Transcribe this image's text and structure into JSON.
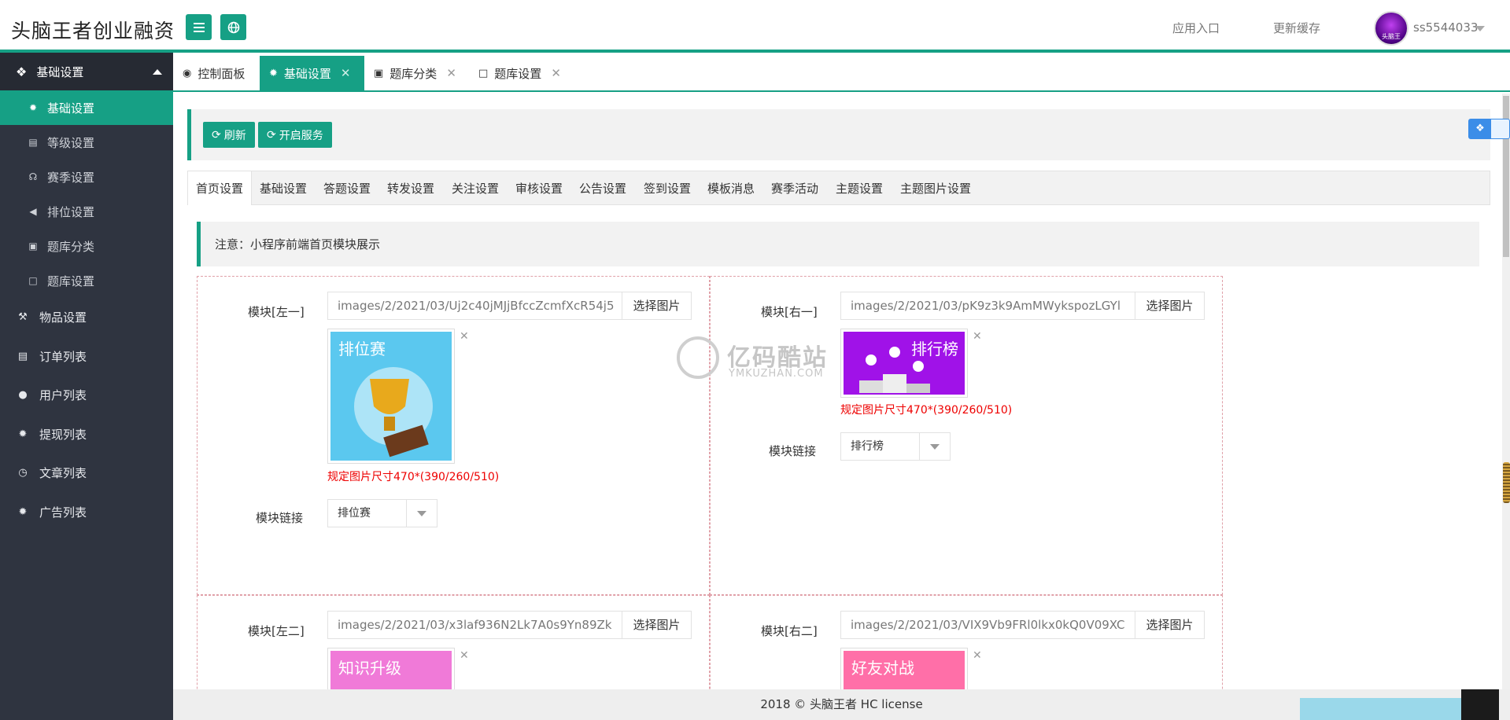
{
  "header": {
    "brand": "头脑王者创业融资",
    "app_entry": "应用入口",
    "update_cache": "更新缓存",
    "username": "ss5544033",
    "avatar_text": "头脑王"
  },
  "sidebar": {
    "group": {
      "label": "基础设置",
      "icon": "cubes-icon"
    },
    "subitems": [
      {
        "label": "基础设置",
        "icon": "gear-icon",
        "active": true
      },
      {
        "label": "等级设置",
        "icon": "layers-icon"
      },
      {
        "label": "赛季设置",
        "icon": "headphones-icon"
      },
      {
        "label": "排位设置",
        "icon": "arrow-circle-icon"
      },
      {
        "label": "题库分类",
        "icon": "doc-icon"
      },
      {
        "label": "题库设置",
        "icon": "chat-icon"
      }
    ],
    "items": [
      {
        "label": "物品设置",
        "icon": "gavel-icon"
      },
      {
        "label": "订单列表",
        "icon": "file-icon"
      },
      {
        "label": "用户列表",
        "icon": "users-icon"
      },
      {
        "label": "提现列表",
        "icon": "cog-icon"
      },
      {
        "label": "文章列表",
        "icon": "clock-icon"
      },
      {
        "label": "广告列表",
        "icon": "cog-icon"
      }
    ]
  },
  "tabs": [
    {
      "label": "控制面板",
      "icon": "dashboard-icon",
      "closable": false
    },
    {
      "label": "基础设置",
      "icon": "gear-icon",
      "closable": true,
      "active": true
    },
    {
      "label": "题库分类",
      "icon": "doc-icon",
      "closable": true
    },
    {
      "label": "题库设置",
      "icon": "chat-icon",
      "closable": true
    }
  ],
  "toolbar": {
    "refresh": "刷新",
    "start_service": "开启服务"
  },
  "subtabs": [
    "首页设置",
    "基础设置",
    "答题设置",
    "转发设置",
    "关注设置",
    "审核设置",
    "公告设置",
    "签到设置",
    "模板消息",
    "赛季活动",
    "主题设置",
    "主题图片设置"
  ],
  "notice": "注意：小程序前端首页模块展示",
  "modules": [
    {
      "label": "模块[左一]",
      "path": "images/2/2021/03/Uj2c40jMJjBfccZcmfXcR54j5",
      "pick": "选择图片",
      "thumb_title": "排位赛",
      "hint": "规定图片尺寸470*(390/260/510)",
      "link_label": "模块链接",
      "link_value": "排位赛"
    },
    {
      "label": "模块[右一]",
      "path": "images/2/2021/03/pK9z3k9AmMWykspozLGYl",
      "pick": "选择图片",
      "thumb_title": "排行榜",
      "hint": "规定图片尺寸470*(390/260/510)",
      "link_label": "模块链接",
      "link_value": "排行榜"
    },
    {
      "label": "模块[左二]",
      "path": "images/2/2021/03/x3laf936N2Lk7A0s9Yn89Zk",
      "pick": "选择图片",
      "thumb_title": "知识升级"
    },
    {
      "label": "模块[右二]",
      "path": "images/2/2021/03/VIX9Vb9FRl0lkx0kQ0V09XC",
      "pick": "选择图片",
      "thumb_title": "好友对战"
    }
  ],
  "watermark": {
    "title": "亿码酷站",
    "sub": "YMKUZHAN.COM"
  },
  "footer": "2018 ©  头脑王者  HC license",
  "colors": {
    "accent": "#16a085",
    "sidebar": "#2f3440",
    "hint": "#e00000"
  }
}
